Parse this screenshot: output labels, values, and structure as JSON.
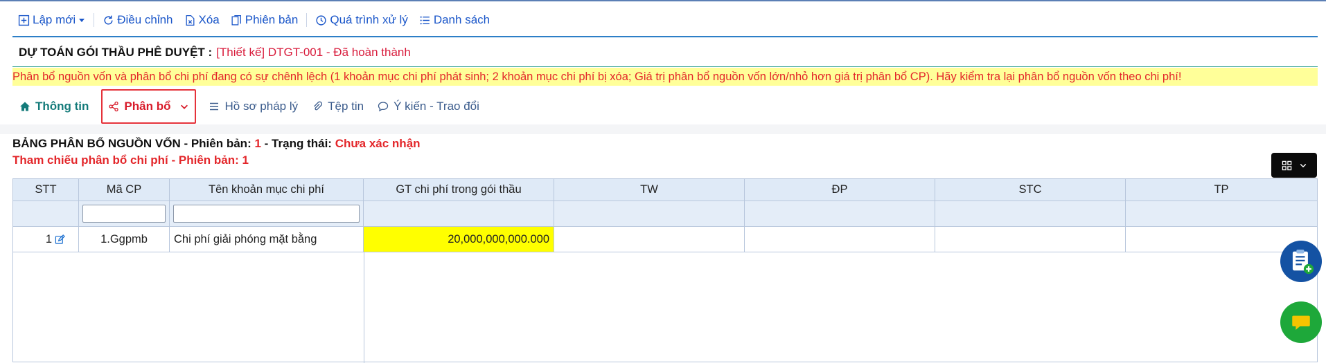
{
  "toolbar": {
    "new_label": "Lập mới",
    "adjust_label": "Điều chỉnh",
    "delete_label": "Xóa",
    "version_label": "Phiên bản",
    "process_label": "Quá trình xử lý",
    "list_label": "Danh sách"
  },
  "header": {
    "title": "DỰ TOÁN GÓI THẦU PHÊ DUYỆT :",
    "status": "[Thiết kế] DTGT-001 - Đã hoàn thành"
  },
  "warning": "Phân bổ nguồn vốn và phân bổ chi phí đang có sự chênh lệch (1 khoản mục chi phí phát sinh; 2 khoản mục chi phí bị xóa; Giá trị phân bổ nguồn vốn lớn/nhỏ hơn giá trị phân bổ CP). Hãy kiểm tra lại phân bổ nguồn vốn theo chi phí!",
  "tabs": {
    "info": "Thông tin",
    "allocation": "Phân bổ",
    "legal": "Hồ sơ pháp lý",
    "files": "Tệp tin",
    "comments": "Ý kiến - Trao đổi"
  },
  "table_header": {
    "title_prefix": "BẢNG PHÂN BỔ NGUỒN VỐN - Phiên bản:",
    "version": "1",
    "status_prefix": "- Trạng thái:",
    "status": "Chưa xác nhận",
    "reference": "Tham chiếu phân bổ chi phí - Phiên bản: 1"
  },
  "columns": {
    "stt": "STT",
    "ma_cp": "Mã CP",
    "ten": "Tên khoản mục chi phí",
    "gt": "GT chi phí trong gói thầu",
    "tw": "TW",
    "dp": "ĐP",
    "stc": "STC",
    "tp": "TP"
  },
  "filters": {
    "ma_cp": "",
    "ten": ""
  },
  "rows": [
    {
      "stt": "1",
      "ma_cp": "1.Ggpmb",
      "ten": "Chi phí giải phóng mặt bằng",
      "gt": "20,000,000,000.000",
      "tw": "",
      "dp": "",
      "stc": "",
      "tp": ""
    }
  ],
  "colors": {
    "accent": "#1a56c9",
    "warning_bg": "#ffff99",
    "warning_text": "#e3262a",
    "highlight": "#ffff00"
  }
}
